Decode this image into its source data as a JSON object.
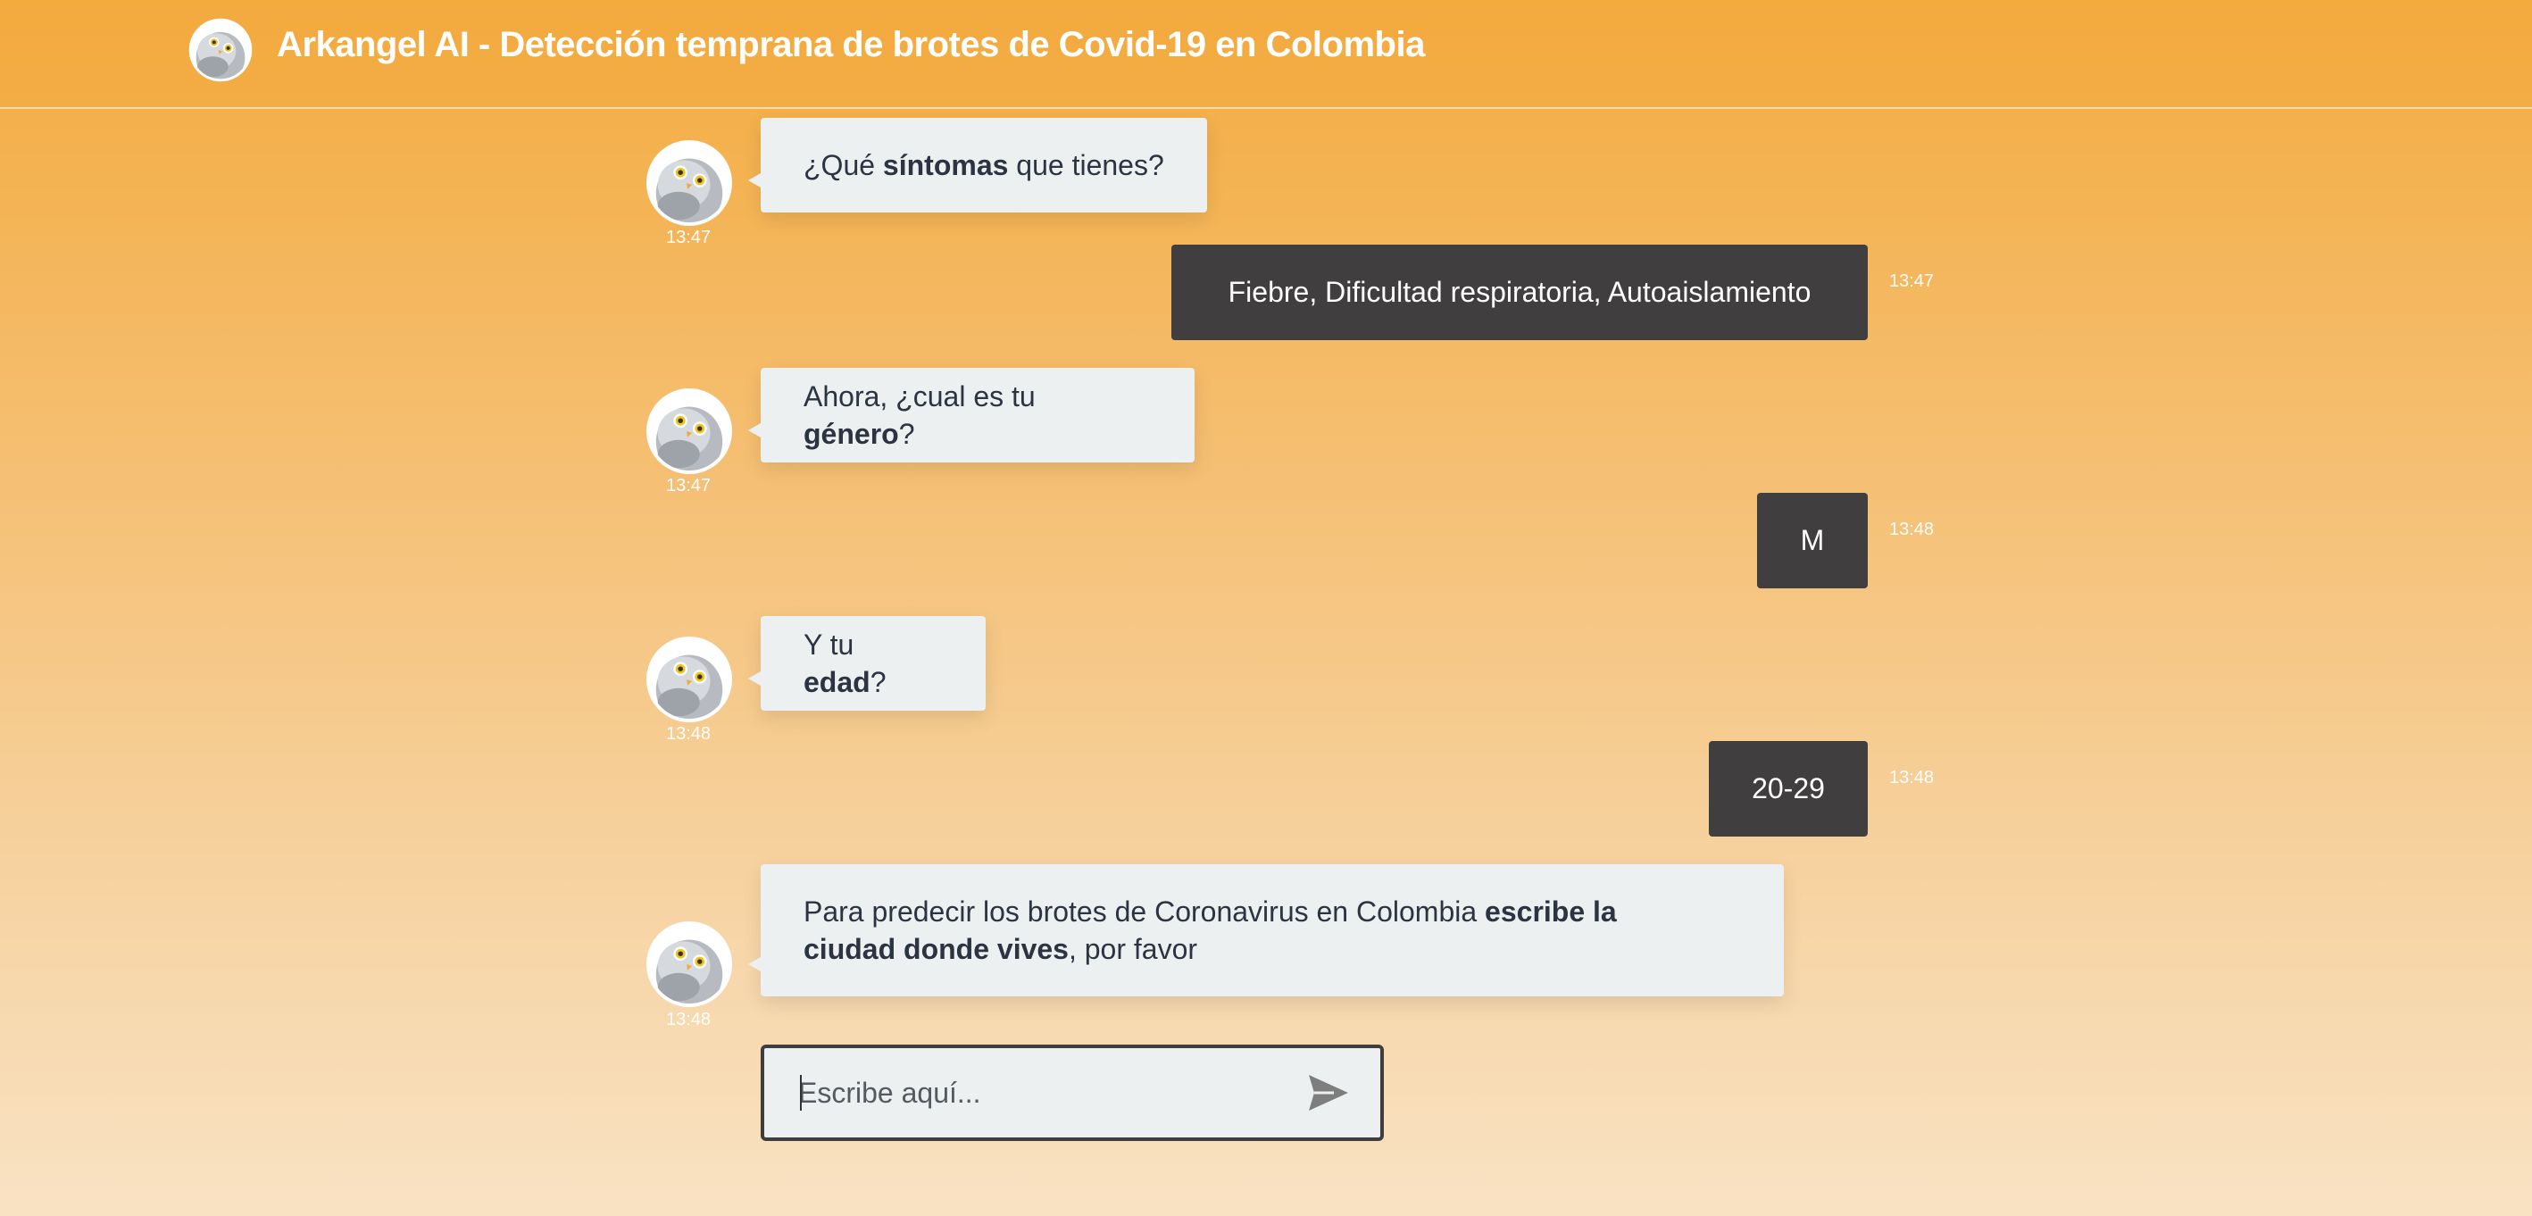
{
  "header": {
    "title": "Arkangel AI - Detección temprana de brotes de Covid-19 en Colombia",
    "avatar_icon": "owl-icon"
  },
  "messages": [
    {
      "from": "bot",
      "pre": "¿Qué ",
      "bold": "síntomas",
      "post": " que tienes?",
      "time": "13:47"
    },
    {
      "from": "user",
      "text": "Fiebre, Dificultad respiratoria, Autoaislamiento",
      "time": "13:47"
    },
    {
      "from": "bot",
      "pre": "Ahora, ¿cual es tu ",
      "bold": "género",
      "post": "?",
      "time": "13:47"
    },
    {
      "from": "user",
      "text": "M",
      "time": "13:48"
    },
    {
      "from": "bot",
      "pre": "Y tu ",
      "bold": "edad",
      "post": "?",
      "time": "13:48"
    },
    {
      "from": "user",
      "text": "20-29",
      "time": "13:48"
    },
    {
      "from": "bot",
      "pre": "Para predecir los brotes de Coronavirus en Colombia ",
      "bold1": "escribe la",
      "bold2": "ciudad donde vives",
      "post": ", por favor",
      "time": "13:48"
    }
  ],
  "input": {
    "placeholder": "Escribe aquí...",
    "value": "",
    "send_icon": "send-icon"
  },
  "colors": {
    "header": "#f3aa3f",
    "bot_bubble": "#ecf0f1",
    "user_bubble": "#403e3f",
    "text_dark": "#2b3440"
  }
}
